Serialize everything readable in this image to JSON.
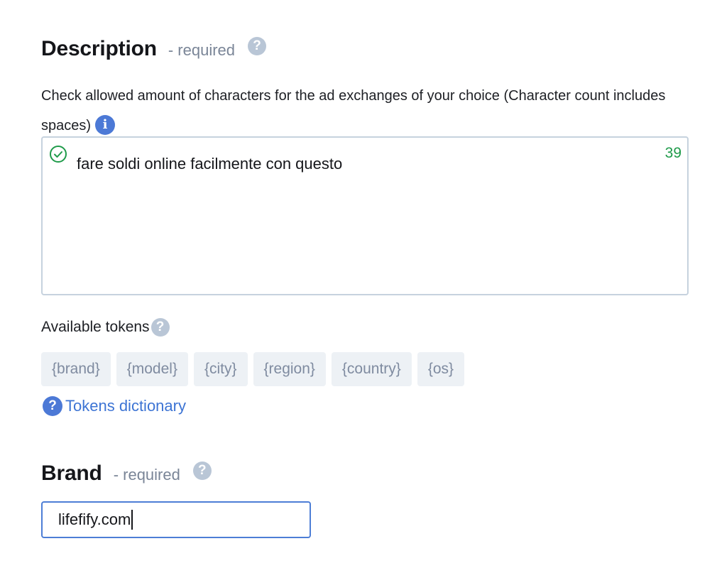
{
  "description": {
    "title": "Description",
    "required": "- required",
    "help_icon": "?",
    "note": "Check allowed amount of characters for the ad exchanges of your choice (Character count includes spaces)",
    "info_icon": "i",
    "value": "fare soldi online facilmente con questo",
    "char_count": "39",
    "valid_icon": "check-circle-icon"
  },
  "tokens": {
    "label": "Available tokens",
    "help_icon": "?",
    "items": [
      "{brand}",
      "{model}",
      "{city}",
      "{region}",
      "{country}",
      "{os}"
    ]
  },
  "dictionary": {
    "icon": "?",
    "label": "Tokens dictionary"
  },
  "brand": {
    "title": "Brand",
    "required": "- required",
    "help_icon": "?",
    "value": "lifefify.com"
  },
  "colors": {
    "accent": "#4c79d6",
    "valid": "#1f9b4a",
    "muted": "#7a8597",
    "token_bg": "#edf1f5"
  }
}
